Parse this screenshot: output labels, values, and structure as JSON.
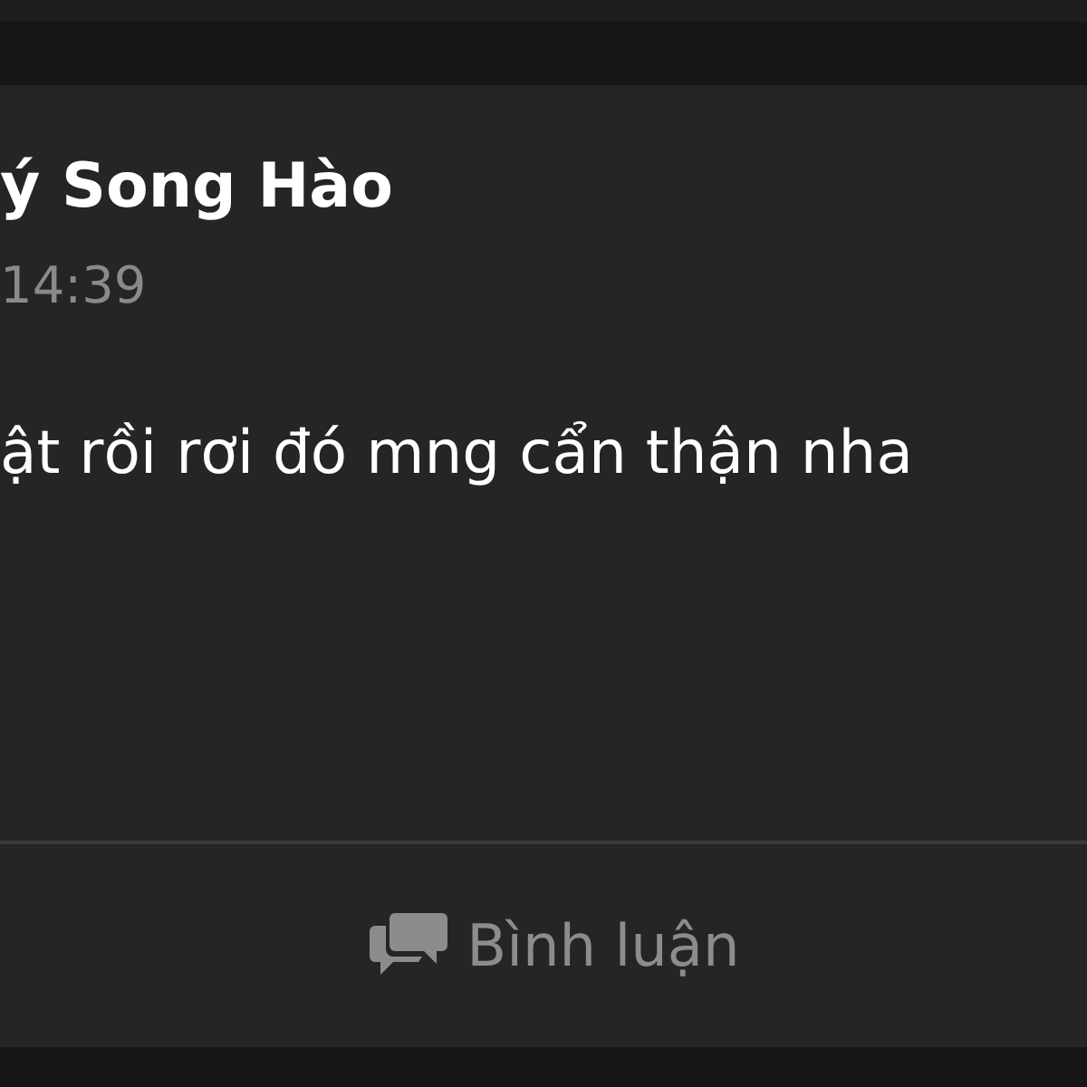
{
  "post": {
    "author": "ý Song Hào",
    "time": "14:39",
    "text": "ật rồi rơi đó mng cẩn thận nha"
  },
  "actions": [
    {
      "kind": "comment",
      "label": "Bình luận"
    }
  ]
}
